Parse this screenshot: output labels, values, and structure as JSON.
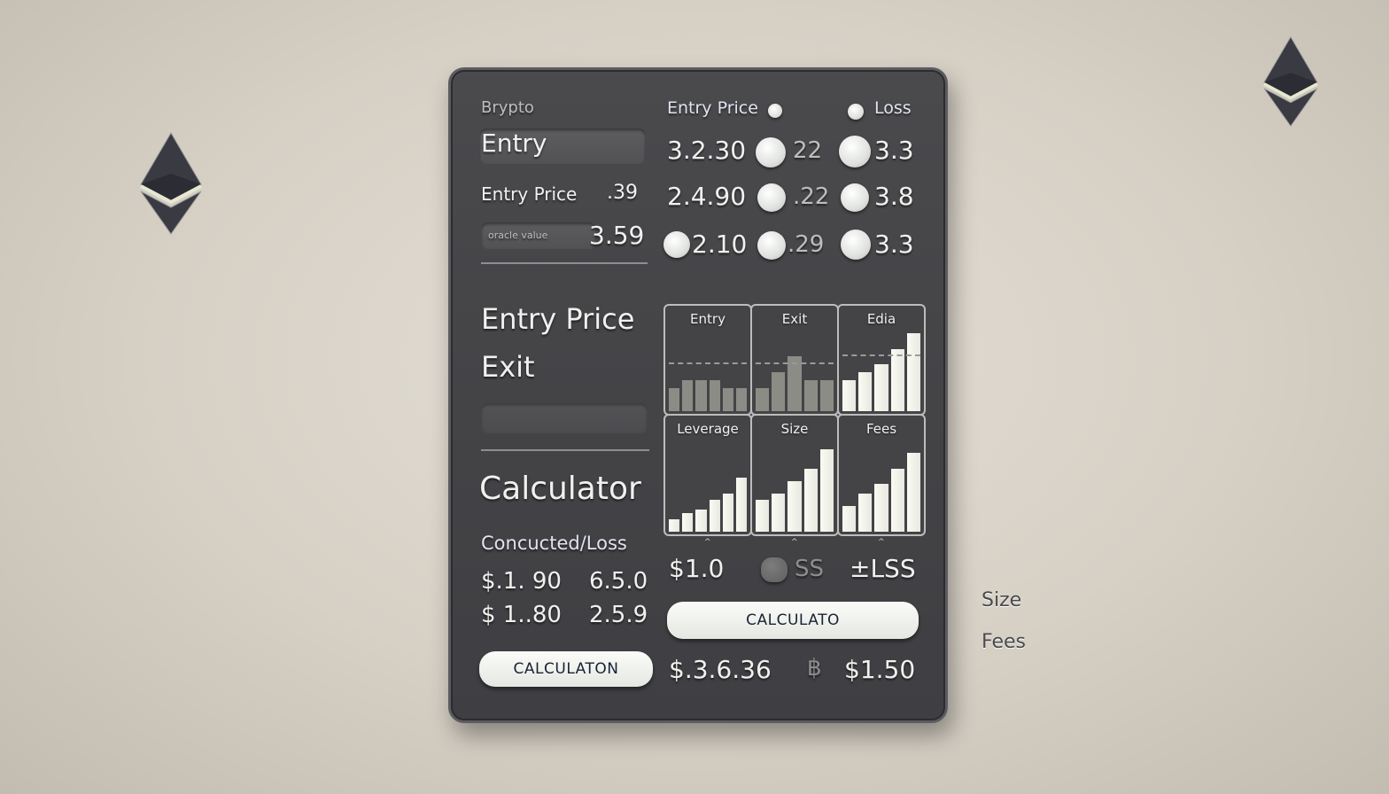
{
  "background_labels": {
    "size": "Size",
    "fees": "Fees"
  },
  "header": {
    "app_label": "Brypto"
  },
  "left": {
    "entry_field_label": "Entry",
    "entry_price_label": "Entry Price",
    "entry_price_value": ".39",
    "input_placeholder": "oracle value",
    "input_value": "3.59",
    "big_entry_price": "Entry Price",
    "big_exit": "Exit",
    "calculator_title": "Calculator",
    "result_label": "Concucted/Loss",
    "results": [
      {
        "a": "$.1. 90",
        "b": "6.5.0"
      },
      {
        "a": "$ 1..80",
        "b": "2.5.9"
      }
    ],
    "calc_button": "CALCULATON"
  },
  "grid": {
    "headers": [
      "Entry Price",
      "Loss"
    ],
    "rows": [
      {
        "c1": "3.2.30",
        "c2": "22",
        "c3": "3.3"
      },
      {
        "c1": "2.4.90",
        "c2": ".22",
        "c3": "3.8"
      },
      {
        "c1": "2.10",
        "c2": ".29",
        "c3": "3.3"
      }
    ]
  },
  "chart_data": [
    {
      "type": "bar",
      "title": "Entry",
      "values": [
        3,
        4,
        4,
        4,
        3,
        3
      ],
      "ref_line": 6
    },
    {
      "type": "bar",
      "title": "Exit",
      "values": [
        3,
        5,
        7,
        4,
        4
      ],
      "ref_line": 6
    },
    {
      "type": "bar",
      "title": "Edia",
      "values": [
        4,
        5,
        6,
        8,
        10
      ],
      "ref_line": 7
    },
    {
      "type": "bar",
      "title": "Leverage",
      "values": [
        2,
        3,
        3.5,
        5,
        6,
        8.5
      ]
    },
    {
      "type": "bar",
      "title": "Size",
      "values": [
        5,
        6,
        8,
        10,
        13
      ]
    },
    {
      "type": "bar",
      "title": "Fees",
      "values": [
        4,
        6,
        7.5,
        10,
        12.5
      ]
    }
  ],
  "bottom_right": {
    "summary": {
      "v1": "$1.0",
      "v2": "SS",
      "v3": "±LSS"
    },
    "calc_button": "CALCULATO",
    "total": {
      "v1": "$.3.6.36",
      "v2": "฿",
      "v3": "$1.50"
    }
  }
}
